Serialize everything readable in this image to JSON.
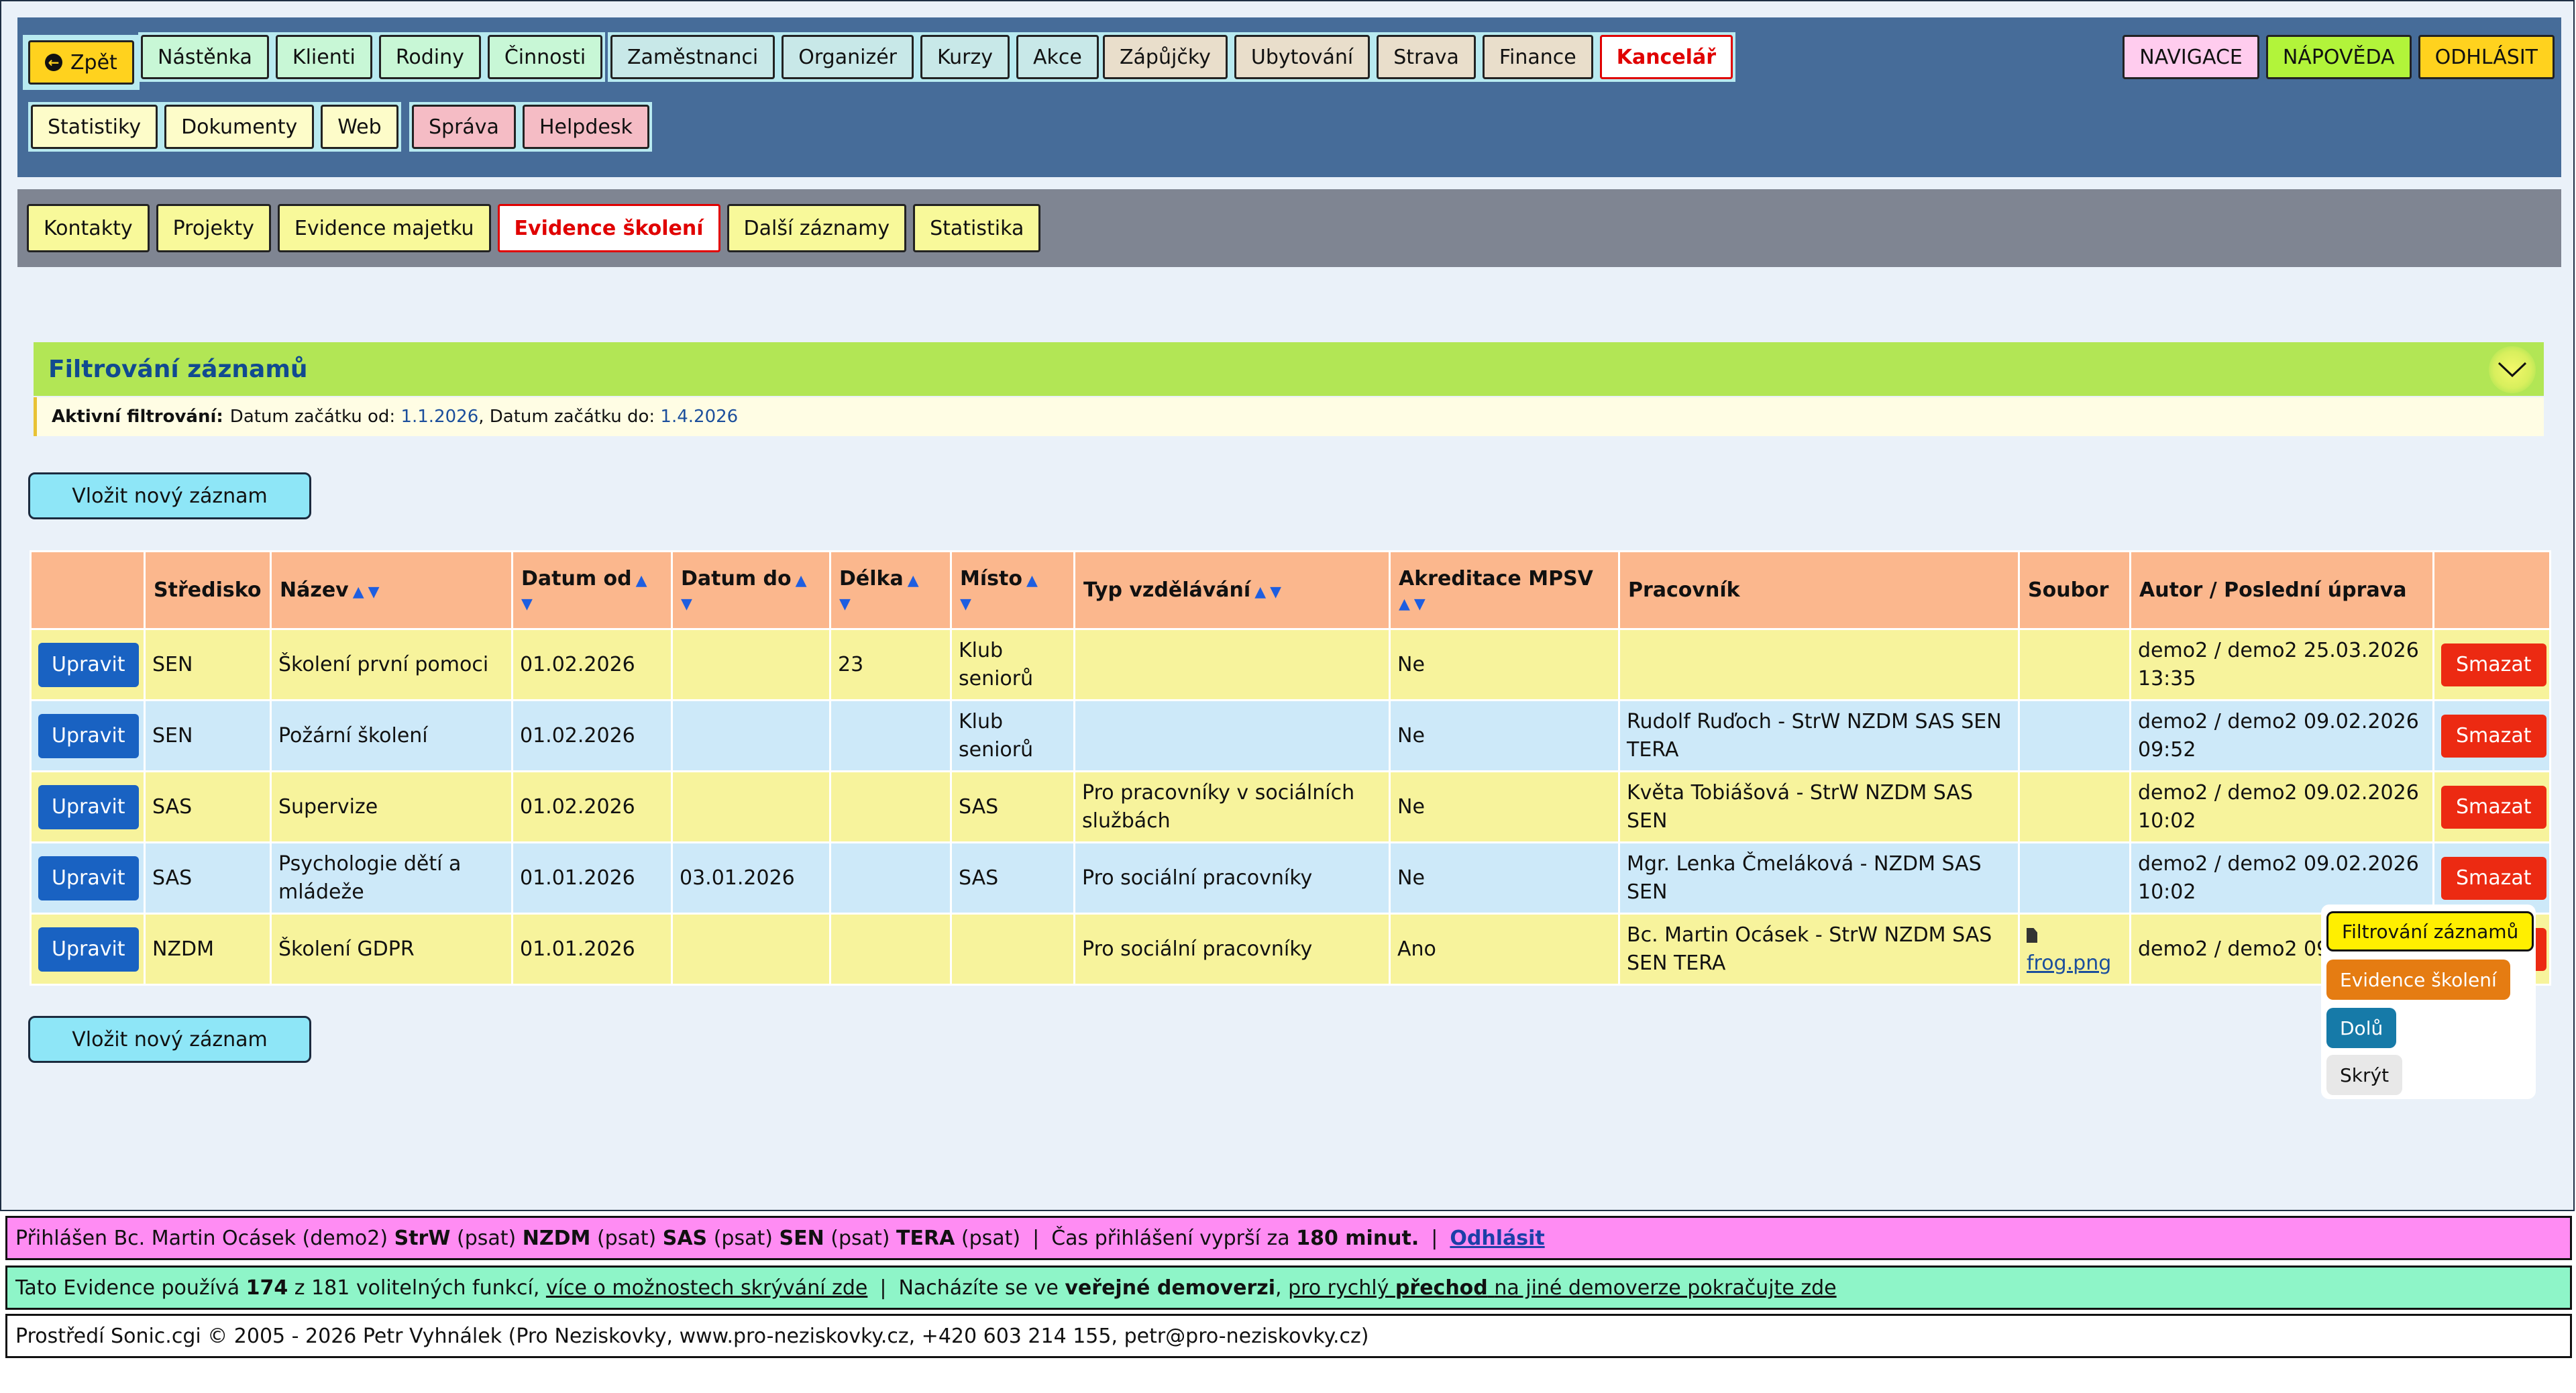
{
  "nav": {
    "back": "Zpět",
    "group1": [
      "Nástěnka",
      "Klienti",
      "Rodiny",
      "Činnosti"
    ],
    "group2": [
      "Zaměstnanci",
      "Organizér",
      "Kurzy",
      "Akce"
    ],
    "group3": [
      "Zápůjčky",
      "Ubytování",
      "Strava",
      "Finance"
    ],
    "group3_active": "Kancelář",
    "group4": [
      "Statistiky",
      "Dokumenty",
      "Web"
    ],
    "group5": [
      "Správa",
      "Helpdesk"
    ],
    "right": [
      "NAVIGACE",
      "NÁPOVĚDA",
      "ODHLÁSIT"
    ]
  },
  "subnav": {
    "items": [
      "Kontakty",
      "Projekty",
      "Evidence majetku",
      "Evidence školení",
      "Další záznamy",
      "Statistika"
    ],
    "active": "Evidence školení"
  },
  "filter": {
    "title": "Filtrování záznamů",
    "active_label": "Aktivní filtrování:",
    "from_label": "Datum začátku od:",
    "from_value": "1.1.2026",
    "sep": ",",
    "to_label": "Datum začátku do:",
    "to_value": "1.4.2026"
  },
  "new_record": "Vložit nový záznam",
  "table": {
    "headers": [
      "",
      "Středisko",
      "Název",
      "Datum od",
      "Datum do",
      "Délka",
      "Místo",
      "Typ vzdělávání",
      "Akreditace MPSV",
      "Pracovník",
      "Soubor",
      "Autor / Poslední úprava",
      ""
    ],
    "edit_label": "Upravit",
    "delete_label": "Smazat",
    "rows": [
      {
        "stredisko": "SEN",
        "nazev": "Školení první pomoci",
        "od": "01.02.2026",
        "do": "",
        "delka": "23",
        "misto": "Klub seniorů",
        "typ": "",
        "akreditace": "Ne",
        "pracovnik": "",
        "soubor": "",
        "autor": "demo2 / demo2 25.03.2026 13:35"
      },
      {
        "stredisko": "SEN",
        "nazev": "Požární školení",
        "od": "01.02.2026",
        "do": "",
        "delka": "",
        "misto": "Klub seniorů",
        "typ": "",
        "akreditace": "Ne",
        "pracovnik": "Rudolf Ruďoch - StrW NZDM SAS SEN TERA",
        "soubor": "",
        "autor": "demo2 / demo2 09.02.2026 09:52"
      },
      {
        "stredisko": "SAS",
        "nazev": "Supervize",
        "od": "01.02.2026",
        "do": "",
        "delka": "",
        "misto": "SAS",
        "typ": "Pro pracovníky v sociálních službách",
        "akreditace": "Ne",
        "pracovnik": "Květa Tobiášová - StrW NZDM SAS SEN",
        "soubor": "",
        "autor": "demo2 / demo2 09.02.2026 10:02"
      },
      {
        "stredisko": "SAS",
        "nazev": "Psychologie dětí a mládeže",
        "od": "01.01.2026",
        "do": "03.01.2026",
        "delka": "",
        "misto": "SAS",
        "typ": "Pro sociální pracovníky",
        "akreditace": "Ne",
        "pracovnik": "Mgr. Lenka Čmeláková - NZDM SAS SEN",
        "soubor": "",
        "autor": "demo2 / demo2 09.02.2026 10:02"
      },
      {
        "stredisko": "NZDM",
        "nazev": "Školení GDPR",
        "od": "01.01.2026",
        "do": "",
        "delka": "",
        "misto": "",
        "typ": "Pro sociální pracovníky",
        "akreditace": "Ano",
        "pracovnik": "Bc. Martin Ocásek - StrW NZDM SAS SEN TERA",
        "soubor": "frog.png",
        "autor": "demo2 / demo2 09 09:32"
      }
    ]
  },
  "quickmenu": {
    "filter": "Filtrování záznamů",
    "evidence": "Evidence školení",
    "down": "Dolů",
    "hide": "Skrýt"
  },
  "footer1": {
    "prefix": "Přihlášen Bc. Martin Ocásek (demo2)",
    "units": [
      [
        "StrW",
        "(psat)"
      ],
      [
        "NZDM",
        "(psat)"
      ],
      [
        "SAS",
        "(psat)"
      ],
      [
        "SEN",
        "(psat)"
      ],
      [
        "TERA",
        "(psat)"
      ]
    ],
    "time_text": "Čas přihlášení vyprší za",
    "time_value": "180 minut.",
    "logout": "Odhlásit"
  },
  "footer2": {
    "t1": "Tato Evidence používá",
    "used": "174",
    "t2": "z 181 volitelných funkcí,",
    "link1": "více o možnostech skrývání zde",
    "t3": "Nacházíte se ve",
    "demo": "veřejné demoverzi",
    "link2a": "pro rychlý",
    "link2b": "přechod",
    "link2c": "na jiné demoverze pokračujte zde"
  },
  "footer3": {
    "t1": "Prostředí",
    "env": "Sonic.cgi",
    "t2": "© 2005 - 2026 Petr Vyhnálek (Pro Neziskovky,",
    "web": "www.pro-neziskovky.cz",
    "t3": ", +420 603 214 155,",
    "email": "petr@pro-neziskovky.cz",
    "t4": ")"
  },
  "colors": {
    "nav_bg": "#466c99",
    "group1_bg": "#c8f7d6",
    "group2_bg": "#c8e8e8",
    "group3_bg": "#e9decb",
    "group4_bg": "#fdfcc9",
    "group5_bg": "#f5bcc5",
    "navigace": "#ffccee",
    "napoveda": "#b2f43a",
    "odhlasit": "#ffd21e"
  }
}
